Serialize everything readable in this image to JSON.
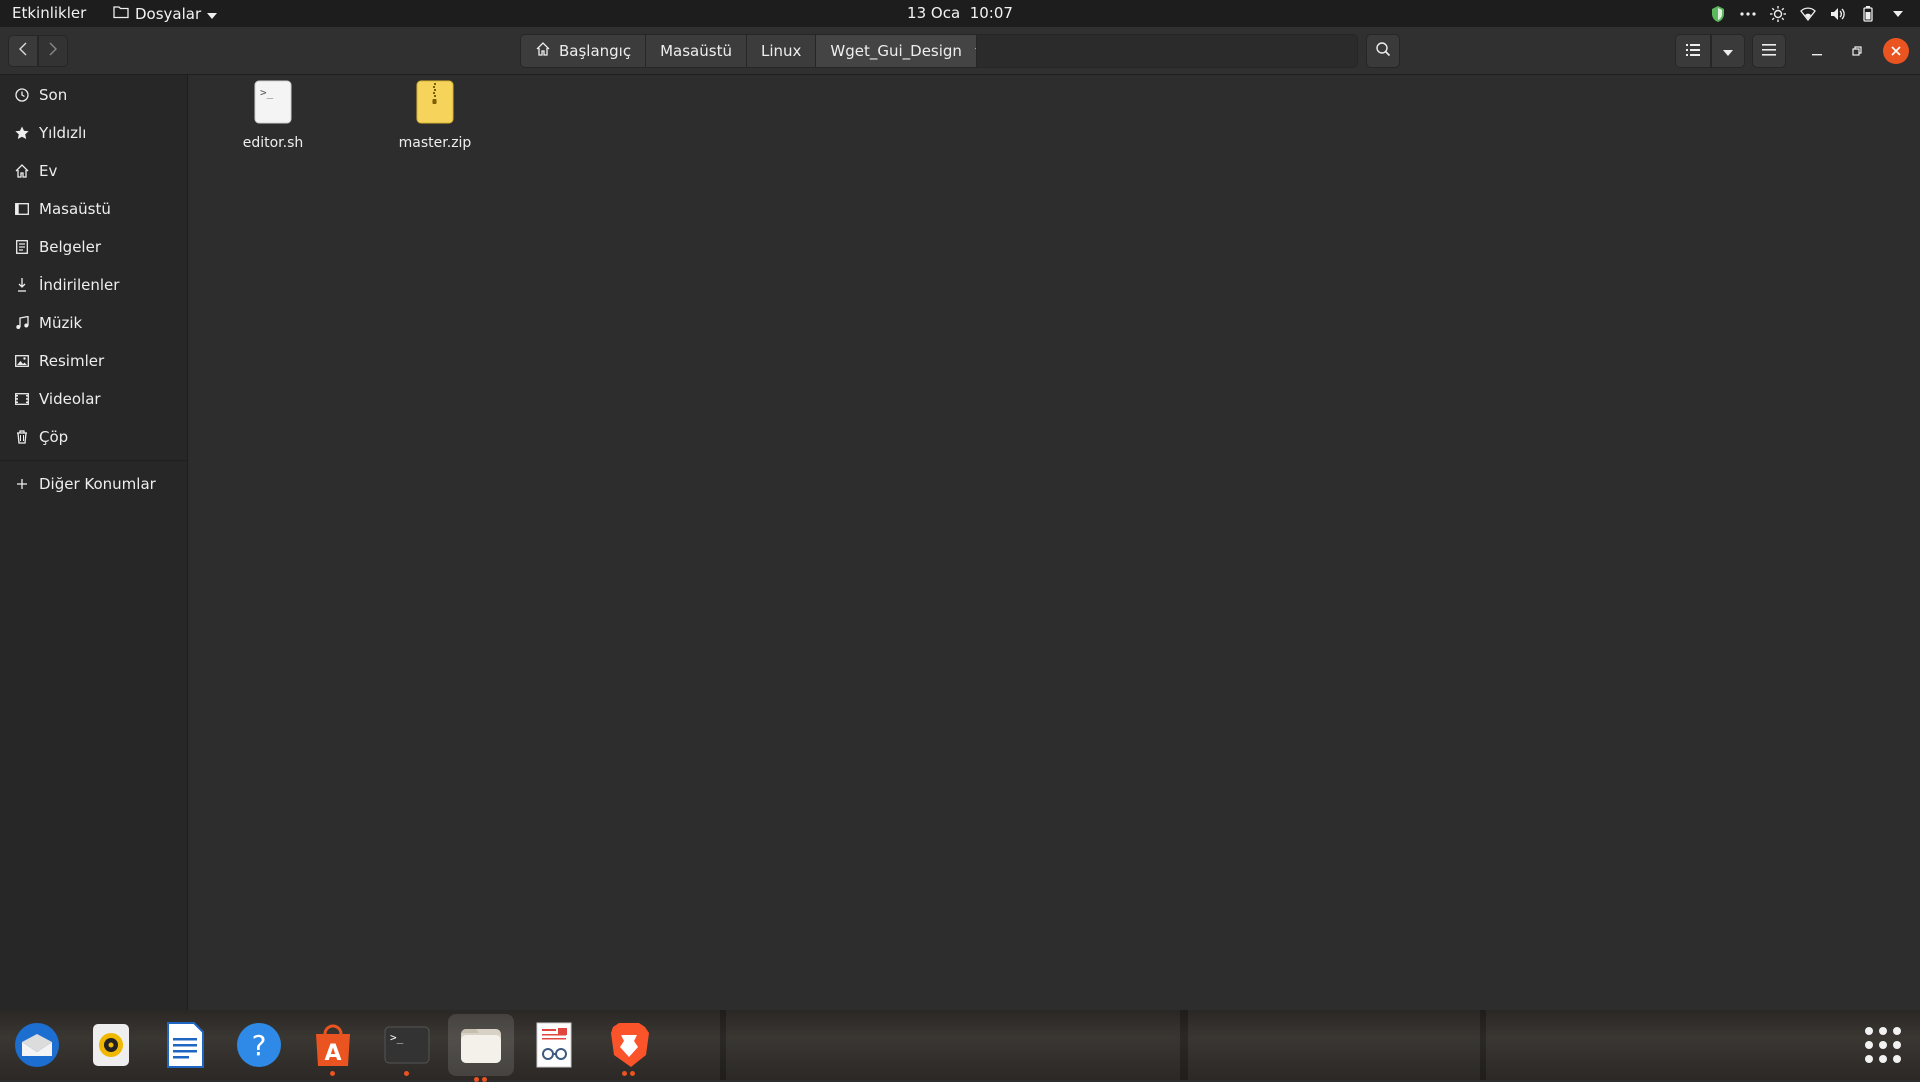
{
  "topbar": {
    "activities": "Etkinlikler",
    "app_name": "Dosyalar",
    "date": "13 Oca",
    "time": "10:07"
  },
  "pathbar": {
    "crumbs": [
      "Başlangıç",
      "Masaüstü",
      "Linux",
      "Wget_Gui_Design"
    ]
  },
  "sidebar": {
    "items": [
      {
        "label": "Son",
        "icon": "clock-icon"
      },
      {
        "label": "Yıldızlı",
        "icon": "star-icon"
      },
      {
        "label": "Ev",
        "icon": "home-icon"
      },
      {
        "label": "Masaüstü",
        "icon": "desktop-icon"
      },
      {
        "label": "Belgeler",
        "icon": "document-icon"
      },
      {
        "label": "İndirilenler",
        "icon": "download-icon"
      },
      {
        "label": "Müzik",
        "icon": "music-icon"
      },
      {
        "label": "Resimler",
        "icon": "image-icon"
      },
      {
        "label": "Videolar",
        "icon": "video-icon"
      },
      {
        "label": "Çöp",
        "icon": "trash-icon"
      }
    ],
    "other_locations": "Diğer Konumlar"
  },
  "files": [
    {
      "name": "editor.sh",
      "icon": "shell-script-icon"
    },
    {
      "name": "master.zip",
      "icon": "zip-archive-icon"
    }
  ],
  "dock": {
    "apps": [
      "thunderbird",
      "rhythmbox",
      "libreoffice-writer",
      "help",
      "software-center",
      "terminal",
      "files",
      "document-viewer",
      "brave-browser"
    ]
  },
  "colors": {
    "accent": "#e95420",
    "background": "#2d2d2d",
    "sidebar": "#272727",
    "topbar": "#1d1d1d"
  }
}
